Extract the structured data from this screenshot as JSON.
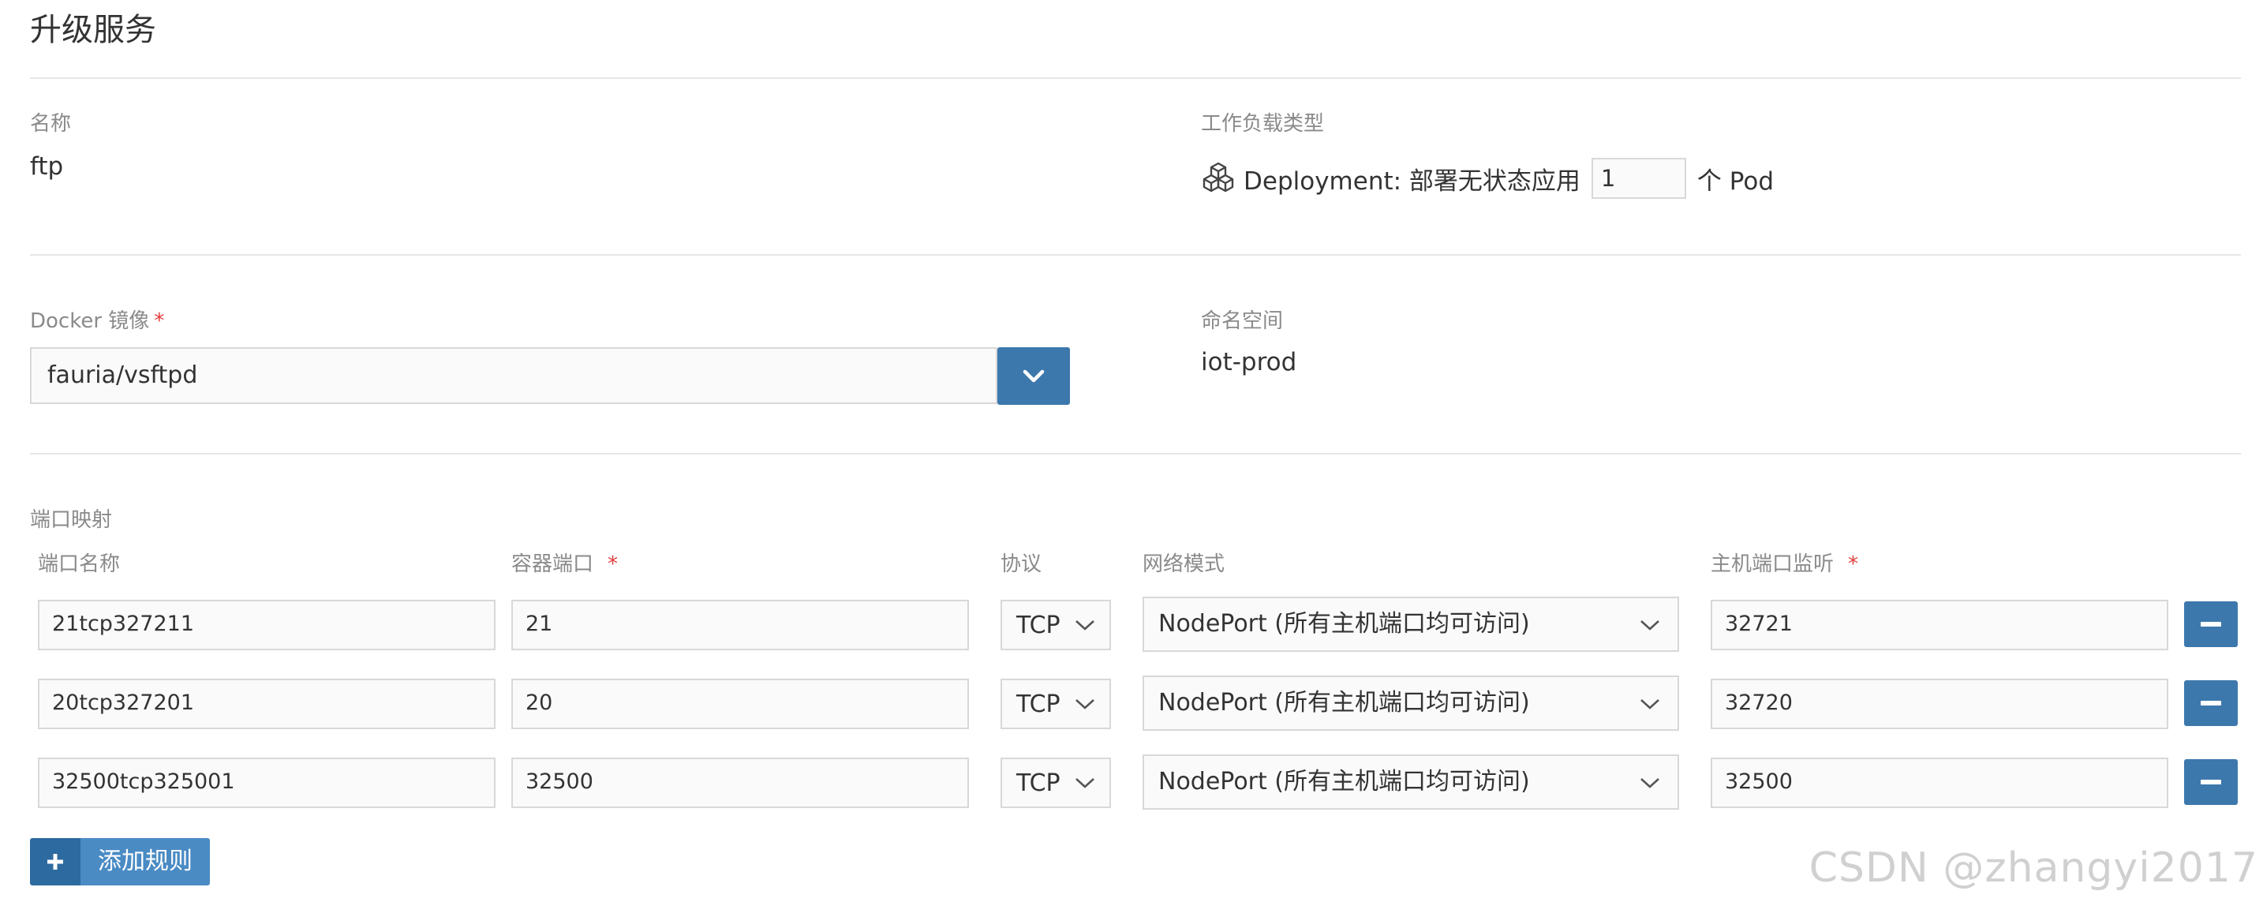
{
  "page": {
    "title": "升级服务"
  },
  "name_field": {
    "label": "名称",
    "value": "ftp"
  },
  "workload": {
    "label": "工作负载类型",
    "type_text": "Deployment: 部署无状态应用",
    "scale": "1",
    "unit": "个 Pod",
    "icon": "cubes-icon"
  },
  "image": {
    "label": "Docker 镜像",
    "required_mark": "*",
    "value": "fauria/vsftpd",
    "button_icon": "chevron-down-icon"
  },
  "namespace": {
    "label": "命名空间",
    "value": "iot-prod"
  },
  "ports": {
    "section_label": "端口映射",
    "headers": {
      "name": "端口名称",
      "container_port": "容器端口",
      "protocol": "协议",
      "network_mode": "网络模式",
      "host_port": "主机端口监听"
    },
    "required_mark": "*",
    "rows": [
      {
        "name": "21tcp327211",
        "container_port": "21",
        "protocol": "TCP",
        "network_mode": "NodePort (所有主机端口均可访问)",
        "host_port": "32721"
      },
      {
        "name": "20tcp327201",
        "container_port": "20",
        "protocol": "TCP",
        "network_mode": "NodePort (所有主机端口均可访问)",
        "host_port": "32720"
      },
      {
        "name": "32500tcp325001",
        "container_port": "32500",
        "protocol": "TCP",
        "network_mode": "NodePort (所有主机端口均可访问)",
        "host_port": "32500"
      }
    ],
    "add_button": "添加规则"
  },
  "watermark": "CSDN @zhangyi2017",
  "colors": {
    "primary": "#3d78ad",
    "required": "#e23b3b",
    "border": "#d8d8d8"
  }
}
